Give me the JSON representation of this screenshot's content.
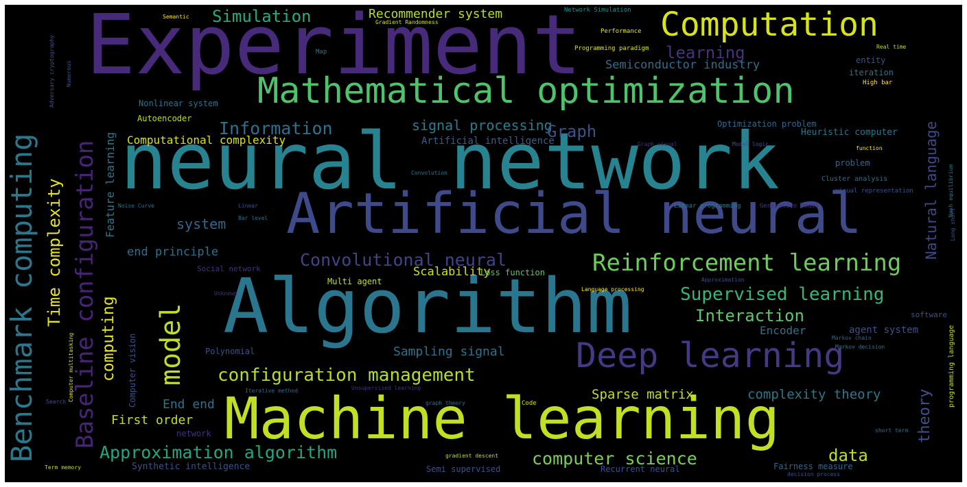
{
  "colors": {
    "background": "#000000",
    "dark_purple": "#440154",
    "purple": "#472f7d",
    "slate": "#3b528b",
    "blue": "#2c728e",
    "teal": "#21918c",
    "green_teal": "#28ae80",
    "green": "#5ec962",
    "lime": "#addc30",
    "yellow": "#fde725"
  },
  "words": [
    {
      "id": "experiment",
      "text": "Experiment",
      "color": "#472a7a"
    },
    {
      "id": "neural-network",
      "text": "neural network",
      "color": "#26838f"
    },
    {
      "id": "artificial-neural",
      "text": "Artificial neural",
      "color": "#3e4a89"
    },
    {
      "id": "algorithm",
      "text": "Algorithm",
      "color": "#2a768e"
    },
    {
      "id": "machine-learning",
      "text": "Machine learning",
      "color": "#c2df23"
    },
    {
      "id": "mathematical-optimization",
      "text": "Mathematical optimization",
      "color": "#4ec36b"
    },
    {
      "id": "computation",
      "text": "Computation",
      "color": "#d8e219"
    },
    {
      "id": "benchmark-computing",
      "text": "Benchmark computing",
      "color": "#2a788e"
    },
    {
      "id": "baseline-configuration",
      "text": "Baseline configuration",
      "color": "#482475"
    },
    {
      "id": "deep-learning",
      "text": "Deep learning",
      "color": "#443983"
    },
    {
      "id": "reinforcement-learning",
      "text": "Reinforcement learning",
      "color": "#6ccd5a"
    },
    {
      "id": "model",
      "text": "model",
      "color": "#bddf26"
    },
    {
      "id": "configuration-management",
      "text": "configuration management",
      "color": "#b5de2b"
    },
    {
      "id": "supervised-learning",
      "text": "Supervised learning",
      "color": "#35b779"
    },
    {
      "id": "approximation-algorithm",
      "text": "Approximation algorithm",
      "color": "#22a785"
    },
    {
      "id": "computer-science",
      "text": "computer science",
      "color": "#7ad151"
    },
    {
      "id": "convolutional-neural",
      "text": "Convolutional neural",
      "color": "#414487"
    },
    {
      "id": "information",
      "text": "Information",
      "color": "#2c728e"
    },
    {
      "id": "signal-processing",
      "text": "signal processing",
      "color": "#287d8e"
    },
    {
      "id": "graph",
      "text": "Graph",
      "color": "#3b528b"
    },
    {
      "id": "simulation",
      "text": "Simulation",
      "color": "#25ab82"
    },
    {
      "id": "recommender-system",
      "text": "Recommender system",
      "color": "#b8de29"
    },
    {
      "id": "learning",
      "text": "learning",
      "color": "#46327e"
    },
    {
      "id": "semiconductor-industry",
      "text": "Semiconductor industry",
      "color": "#2d708e"
    },
    {
      "id": "natural-language",
      "text": "Natural language",
      "color": "#3e4989"
    },
    {
      "id": "time-complexity",
      "text": "Time complexity",
      "color": "#e5e419"
    },
    {
      "id": "feature-learning",
      "text": "Feature learning",
      "color": "#2a788e"
    },
    {
      "id": "computing",
      "text": "computing",
      "color": "#e7e419"
    },
    {
      "id": "interaction",
      "text": "Interaction",
      "color": "#5ec962"
    },
    {
      "id": "theory",
      "text": "theory",
      "color": "#3b528b"
    },
    {
      "id": "data",
      "text": "data",
      "color": "#bade28"
    },
    {
      "id": "sparse-matrix",
      "text": "Sparse matrix",
      "color": "#bddf26"
    },
    {
      "id": "complexity-theory",
      "text": "complexity theory",
      "color": "#2a788e"
    },
    {
      "id": "sampling-signal",
      "text": "Sampling signal",
      "color": "#2c728e"
    },
    {
      "id": "end-end",
      "text": "End end",
      "color": "#2c728e"
    },
    {
      "id": "first-order",
      "text": "First order",
      "color": "#bddf26"
    },
    {
      "id": "computational-complexity",
      "text": "Computational complexity",
      "color": "#d8e219"
    },
    {
      "id": "system",
      "text": "system",
      "color": "#31688e"
    },
    {
      "id": "end-principle",
      "text": "end principle",
      "color": "#2c728e"
    },
    {
      "id": "scalability",
      "text": "Scalability",
      "color": "#d0e11c"
    },
    {
      "id": "encoder",
      "text": "Encoder",
      "color": "#2c728e"
    },
    {
      "id": "agent-system",
      "text": "agent system",
      "color": "#3b528b"
    },
    {
      "id": "artificial-intelligence",
      "text": "Artificial intelligence",
      "color": "#35608d"
    },
    {
      "id": "nonlinear-system",
      "text": "Nonlinear system",
      "color": "#2c728e"
    },
    {
      "id": "autoencoder",
      "text": "Autoencoder",
      "color": "#bddf26"
    },
    {
      "id": "heuristic-computer",
      "text": "Heuristic computer",
      "color": "#2a788e"
    },
    {
      "id": "optimization-problem",
      "text": "Optimization problem",
      "color": "#31688e"
    },
    {
      "id": "network-simulation",
      "text": "Network Simulation",
      "color": "#21918c"
    },
    {
      "id": "gradient-randomness",
      "text": "Gradient Randomness",
      "color": "#d0e11c"
    },
    {
      "id": "semantic",
      "text": "Semantic",
      "color": "#fde725"
    },
    {
      "id": "performance",
      "text": "Performance",
      "color": "#e7e419"
    },
    {
      "id": "programming-paradigm",
      "text": "Programming paradigm",
      "color": "#d8e219"
    },
    {
      "id": "map",
      "text": "Map",
      "color": "#2a788e"
    },
    {
      "id": "real-time",
      "text": "Real time",
      "color": "#bddf26"
    },
    {
      "id": "entity",
      "text": "entity",
      "color": "#3b528b"
    },
    {
      "id": "iteration",
      "text": "iteration",
      "color": "#2c728e"
    },
    {
      "id": "high-bar",
      "text": "High bar",
      "color": "#fde725"
    },
    {
      "id": "graph-visual",
      "text": "Graph visual",
      "color": "#46327e"
    },
    {
      "id": "modal-logic",
      "text": "Modal logic",
      "color": "#3b528b"
    },
    {
      "id": "function",
      "text": "function",
      "color": "#fde725"
    },
    {
      "id": "problem",
      "text": "problem",
      "color": "#31688e"
    },
    {
      "id": "cluster-analysis",
      "text": "Cluster analysis",
      "color": "#2c728e"
    },
    {
      "id": "visual-representation",
      "text": "visual representation",
      "color": "#3b528b"
    },
    {
      "id": "linear-programming",
      "text": "Linear programming",
      "color": "#2a788e"
    },
    {
      "id": "generative-model",
      "text": "Generative model",
      "color": "#46327e"
    },
    {
      "id": "convolution",
      "text": "Convolution",
      "color": "#2a788e"
    },
    {
      "id": "noise-curve",
      "text": "Noise Curve",
      "color": "#2c728e"
    },
    {
      "id": "linear",
      "text": "Linear",
      "color": "#3b528b"
    },
    {
      "id": "bar-level",
      "text": "Bar level",
      "color": "#2c728e"
    },
    {
      "id": "social-network",
      "text": "Social network",
      "color": "#46327e"
    },
    {
      "id": "multi-agent",
      "text": "Multi agent",
      "color": "#bddf26"
    },
    {
      "id": "loss-function",
      "text": "Loss function",
      "color": "#5ec962"
    },
    {
      "id": "approximation",
      "text": "Approximation",
      "color": "#3b528b"
    },
    {
      "id": "language-processing",
      "text": "Language processing",
      "color": "#fde725"
    },
    {
      "id": "software",
      "text": "software",
      "color": "#3b528b"
    },
    {
      "id": "markov-chain",
      "text": "Markov chain",
      "color": "#31688e"
    },
    {
      "id": "markov-decision",
      "text": "Markov decision",
      "color": "#2a788e"
    },
    {
      "id": "polynomial",
      "text": "Polynomial",
      "color": "#3b528b"
    },
    {
      "id": "computer-vision",
      "text": "Computer vision",
      "color": "#3b528b"
    },
    {
      "id": "unsupervised-learning",
      "text": "Unsupervised learning",
      "color": "#46327e"
    },
    {
      "id": "iterative-method",
      "text": "Iterative method",
      "color": "#31688e"
    },
    {
      "id": "graph-theory",
      "text": "graph theory",
      "color": "#2c728e"
    },
    {
      "id": "code",
      "text": "Code",
      "color": "#d8e219"
    },
    {
      "id": "gradient-descent",
      "text": "gradient descent",
      "color": "#bddf26"
    },
    {
      "id": "network",
      "text": "network",
      "color": "#46327e"
    },
    {
      "id": "synthetic-intelligence",
      "text": "Synthetic intelligence",
      "color": "#3b528b"
    },
    {
      "id": "semi-supervised",
      "text": "Semi supervised",
      "color": "#3b528b"
    },
    {
      "id": "recurrent-neural",
      "text": "Recurrent neural",
      "color": "#3b528b"
    },
    {
      "id": "decision-process",
      "text": "decision process",
      "color": "#3b528b"
    },
    {
      "id": "fairness-measure",
      "text": "Fairness measure",
      "color": "#31688e"
    },
    {
      "id": "short-term",
      "text": "short term",
      "color": "#2c728e"
    },
    {
      "id": "term-memory",
      "text": "Term memory",
      "color": "#bddf26"
    },
    {
      "id": "search",
      "text": "Search",
      "color": "#3b528b"
    },
    {
      "id": "computer-multitasking",
      "text": "Computer multitasking",
      "color": "#d8e219"
    },
    {
      "id": "adversary-cryptography",
      "text": "Adversary cryptography",
      "color": "#3b528b"
    },
    {
      "id": "numerous",
      "text": "Numerous",
      "color": "#3b528b"
    },
    {
      "id": "programming-language",
      "text": "programming language",
      "color": "#bddf26"
    },
    {
      "id": "long-short",
      "text": "Long short",
      "color": "#3b528b"
    },
    {
      "id": "nash-equilibrium",
      "text": "Nash equilibrium",
      "color": "#2a788e"
    },
    {
      "id": "network-sim-small",
      "text": "Unknown",
      "color": "#46327e"
    }
  ]
}
